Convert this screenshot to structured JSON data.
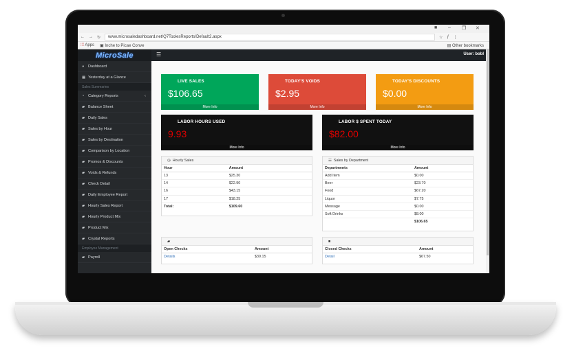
{
  "browser": {
    "url": "www.microsaledashboard.net/Q7ToolesReports/Default2.aspx",
    "apps_label": "Apps",
    "bookmark_1": "Inche to Picae Conve",
    "other_bookmarks": "Other bookmarks"
  },
  "app": {
    "logo": "MicroSale",
    "user_label": "User:",
    "user_name": "bobl"
  },
  "sidebar": {
    "items": [
      {
        "label": "Dashboard",
        "icon": "dashboard-icon"
      },
      {
        "label": "Yesterday at a Glance",
        "icon": "grid-icon"
      }
    ],
    "section_sales": "Sales Summaries",
    "sales_items": [
      {
        "label": "Category Reports",
        "icon": "pie-icon"
      },
      {
        "label": "Balance Sheet",
        "icon": "book-icon"
      },
      {
        "label": "Daily Sales",
        "icon": "book-icon"
      },
      {
        "label": "Sales by Hour",
        "icon": "book-icon"
      },
      {
        "label": "Sales by Destination",
        "icon": "book-icon"
      },
      {
        "label": "Comparison by Location",
        "icon": "book-icon"
      },
      {
        "label": "Promos & Discounts",
        "icon": "book-icon"
      },
      {
        "label": "Voids & Refunds",
        "icon": "book-icon"
      },
      {
        "label": "Check Detail",
        "icon": "book-icon"
      },
      {
        "label": "Daily Employee Report",
        "icon": "book-icon"
      },
      {
        "label": "Hourly Sales Report",
        "icon": "book-icon"
      },
      {
        "label": "Hourly Product Mix",
        "icon": "book-icon"
      },
      {
        "label": "Product Mix",
        "icon": "book-icon"
      },
      {
        "label": "Crystal Reports",
        "icon": "book-icon"
      }
    ],
    "section_employee": "Employee Management",
    "employee_items": [
      {
        "label": "Payroll",
        "icon": "book-icon"
      }
    ]
  },
  "stats": {
    "live_sales": {
      "title": "LIVE SALES",
      "value": "$106.65",
      "more": "More Info",
      "color": "#00a65a"
    },
    "todays_voids": {
      "title": "TODAY'S VOIDS",
      "value": "$2.95",
      "more": "More Info",
      "color": "#dd4b39"
    },
    "todays_discounts": {
      "title": "TODAY'S DISCOUNTS",
      "value": "$0.00",
      "more": "More Info",
      "color": "#f39c12"
    },
    "labor_hours": {
      "title": "LABOR HOURS USED",
      "value": "9.93",
      "more": "More Info",
      "color": "#111111"
    },
    "labor_spent": {
      "title": "LABOR $ SPENT TODAY",
      "value": "$82.00",
      "more": "More Info",
      "color": "#111111"
    }
  },
  "hourly_sales": {
    "title": "Hourly Sales",
    "headers": [
      "Hour",
      "Amount"
    ],
    "rows": [
      [
        "13",
        "$25.30"
      ],
      [
        "14",
        "$22.90"
      ],
      [
        "16",
        "$43.15"
      ],
      [
        "17",
        "$18.25"
      ]
    ],
    "total_label": "Total:",
    "total_value": "$109.60"
  },
  "sales_by_department": {
    "title": "Sales by Department",
    "headers": [
      "Departments",
      "Amount"
    ],
    "rows": [
      [
        "Add Item",
        "$0.00"
      ],
      [
        "Beer",
        "$23.70"
      ],
      [
        "Food",
        "$67.20"
      ],
      [
        "Liquor",
        "$7.75"
      ],
      [
        "Message",
        "$0.00"
      ],
      [
        "Soft Drinks",
        "$8.00"
      ]
    ],
    "total_value": "$106.65"
  },
  "open_checks": {
    "headers": [
      "Open Checks",
      "Amount"
    ],
    "link": "Details",
    "amount": "$39.15"
  },
  "closed_checks": {
    "headers": [
      "Closed Checks",
      "Amount"
    ],
    "link": "Detail",
    "amount": "$67.50"
  }
}
